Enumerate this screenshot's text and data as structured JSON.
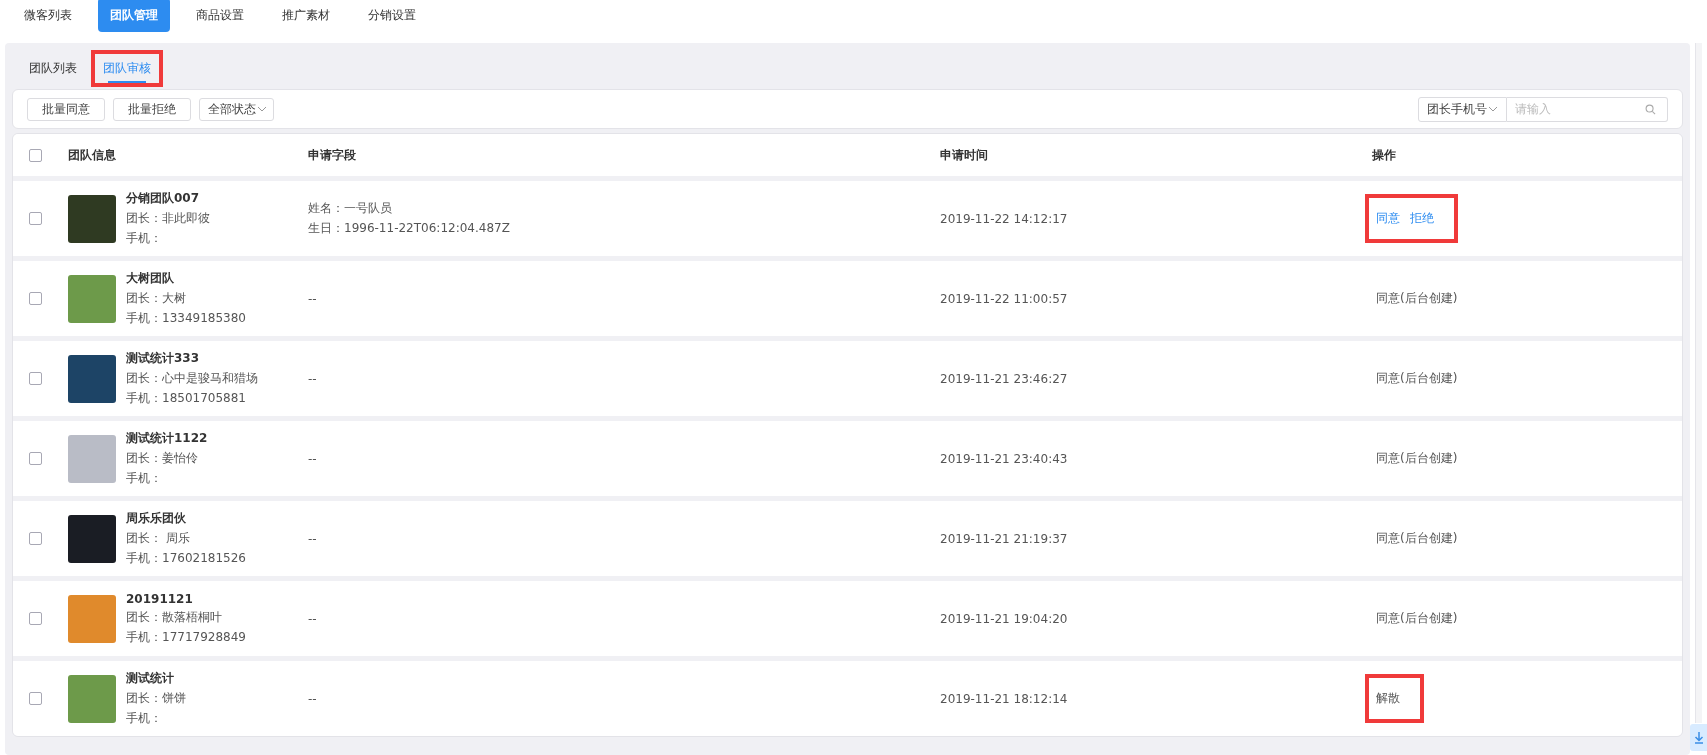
{
  "top_tabs": [
    {
      "label": "微客列表",
      "selected": false
    },
    {
      "label": "团队管理",
      "selected": true
    },
    {
      "label": "商品设置",
      "selected": false
    },
    {
      "label": "推广素材",
      "selected": false
    },
    {
      "label": "分销设置",
      "selected": false
    }
  ],
  "sub_tabs": [
    {
      "label": "团队列表",
      "selected": false,
      "highlighted": false
    },
    {
      "label": "团队审核",
      "selected": true,
      "highlighted": true
    }
  ],
  "toolbar": {
    "buttons": [
      "批量同意",
      "批量拒绝"
    ],
    "status_filter": "全部状态",
    "search_type": "团长手机号",
    "search": {
      "placeholder": "请输入"
    }
  },
  "table": {
    "select_all": {
      "checked": false
    },
    "columns": [
      "团队信息",
      "申请字段",
      "申请时间",
      "操作"
    ],
    "rows": [
      {
        "checked": false,
        "name": "分销团队007",
        "leader": "团长：非此即彼",
        "phone": "手机：",
        "fields": [
          "姓名：一号队员",
          "生日：1996-11-22T06:12:04.487Z"
        ],
        "time": "2019-11-22 14:12:17",
        "highlighted": true,
        "actions": [
          {
            "kind": "link",
            "label": "同意"
          },
          {
            "kind": "link",
            "label": "拒绝"
          }
        ]
      },
      {
        "checked": false,
        "name": "大树团队",
        "leader": "团长：大树",
        "phone": "手机：13349185380",
        "fields": [
          "--"
        ],
        "time": "2019-11-22 11:00:57",
        "highlighted": false,
        "actions": [
          {
            "kind": "text",
            "label": "同意(后台创建)"
          }
        ]
      },
      {
        "checked": false,
        "name": "测试统计333",
        "leader": "团长：心中是骏马和猎场",
        "phone": "手机：18501705881",
        "fields": [
          "--"
        ],
        "time": "2019-11-21 23:46:27",
        "highlighted": false,
        "actions": [
          {
            "kind": "text",
            "label": "同意(后台创建)"
          }
        ]
      },
      {
        "checked": false,
        "name": "测试统计1122",
        "leader": "团长：姜怡伶",
        "phone": "手机：",
        "fields": [
          "--"
        ],
        "time": "2019-11-21 23:40:43",
        "highlighted": false,
        "actions": [
          {
            "kind": "text",
            "label": "同意(后台创建)"
          }
        ]
      },
      {
        "checked": false,
        "name": "周乐乐团伙",
        "leader": "团长： 周乐",
        "phone": "手机：17602181526",
        "fields": [
          "--"
        ],
        "time": "2019-11-21 21:19:37",
        "highlighted": false,
        "actions": [
          {
            "kind": "text",
            "label": "同意(后台创建)"
          }
        ]
      },
      {
        "checked": false,
        "name": "20191121",
        "leader": "团长：散落梧桐叶",
        "phone": "手机：17717928849",
        "fields": [
          "--"
        ],
        "time": "2019-11-21 19:04:20",
        "highlighted": false,
        "actions": [
          {
            "kind": "text",
            "label": "同意(后台创建)"
          }
        ]
      },
      {
        "checked": false,
        "name": "测试统计",
        "leader": "团长：饼饼",
        "phone": "手机：",
        "fields": [
          "--"
        ],
        "time": "2019-11-21 18:12:14",
        "highlighted": true,
        "actions": [
          {
            "kind": "text",
            "label": "解散"
          }
        ]
      }
    ]
  }
}
